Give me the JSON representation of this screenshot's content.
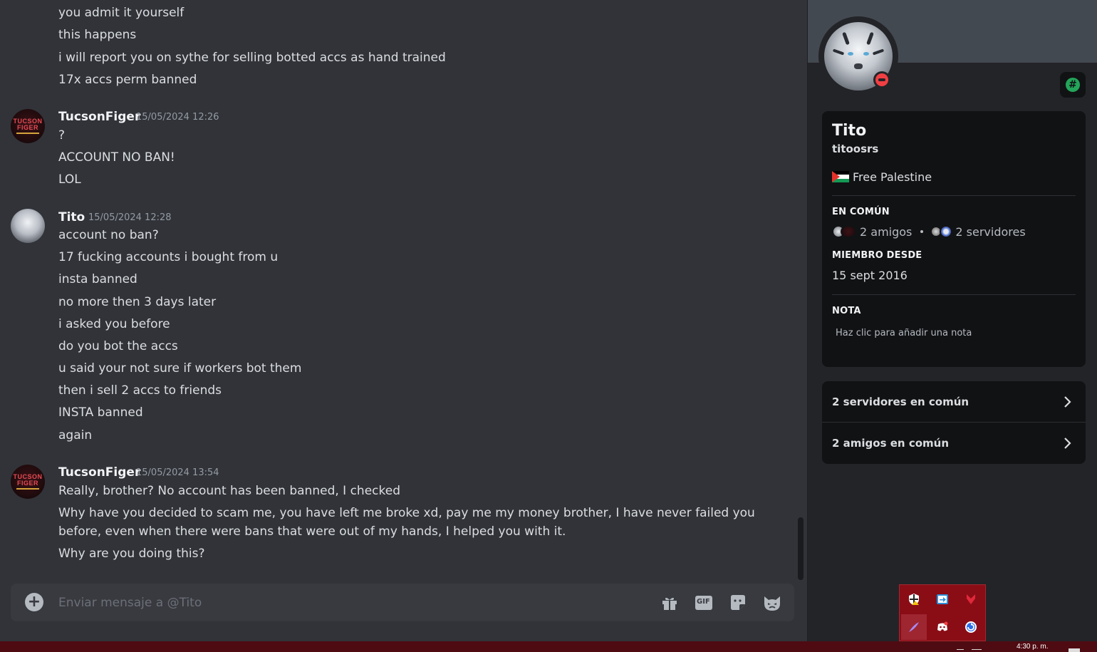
{
  "messages_top": {
    "lines": [
      "you admit it yourself",
      "this happens",
      "i will report you on sythe for selling botted accs as hand trained",
      "17x accs perm banned"
    ]
  },
  "groups": [
    {
      "username": "TucsonFiger",
      "timestamp": "15/05/2024 12:26",
      "avatar_icon": "tucsonfiger-avatar",
      "avatar_text": [
        "TUCSON",
        "FIGER"
      ],
      "lines": [
        "?",
        "ACCOUNT NO BAN!",
        "LOL"
      ]
    },
    {
      "username": "Tito",
      "timestamp": "15/05/2024 12:28",
      "avatar_icon": "white-tiger-avatar",
      "lines": [
        "account no ban?",
        "17 fucking accounts i bought from u",
        "insta banned",
        "no more then 3 days later",
        "i asked you before",
        "do you bot the accs",
        "u said your not sure if workers bot them",
        "then i sell 2 accs to friends",
        "INSTA banned",
        "again"
      ]
    },
    {
      "username": "TucsonFiger",
      "timestamp": "15/05/2024 13:54",
      "avatar_icon": "tucsonfiger-avatar",
      "avatar_text": [
        "TUCSON",
        "FIGER"
      ],
      "lines": [
        "Really, brother? No account has been banned, I checked",
        "Why have you decided to scam me, you have left me broke xd, pay me my money brother, I have never failed you before, even when there were bans that were out of my hands, I helped you with it.",
        "Why are you doing this?"
      ]
    }
  ],
  "composer": {
    "placeholder": "Enviar mensaje a @Tito",
    "icons": [
      "plus-circle-icon",
      "gift-icon",
      "gif-icon",
      "sticker-icon",
      "emoji-icon"
    ],
    "gif_label": "GIF"
  },
  "profile": {
    "display_name": "Tito",
    "username": "titoosrs",
    "status": "do-not-disturb",
    "badge_icon": "hashtag-badge-icon",
    "badge_glyph": "#",
    "custom_status_icon": "palestine-flag-icon",
    "custom_status": "Free Palestine",
    "in_common_title": "EN COMÚN",
    "mutual_friends": "2 amigos",
    "mutual_servers": "2 servidores",
    "member_since_title": "MIEMBRO DESDE",
    "member_since": "15 sept 2016",
    "note_title": "NOTA",
    "note_placeholder": "Haz clic para añadir una nota",
    "mutual_servers_row": "2 servidores en común",
    "mutual_friends_row": "2 amigos en común"
  },
  "tray": {
    "icons": [
      "shield-warning-icon",
      "remote-arrow-icon",
      "red-drop-icon",
      "feather-icon",
      "discord-icon",
      "refresh-circle-icon"
    ]
  },
  "taskbar": {
    "clock": "4:30 p. m."
  },
  "colors": {
    "background": "#313338",
    "panel": "#232428",
    "card": "#111214",
    "dnd": "#f23f43",
    "online_badge": "#23a55a",
    "taskbar": "#4f0b12",
    "tray": "#8a0d16"
  }
}
